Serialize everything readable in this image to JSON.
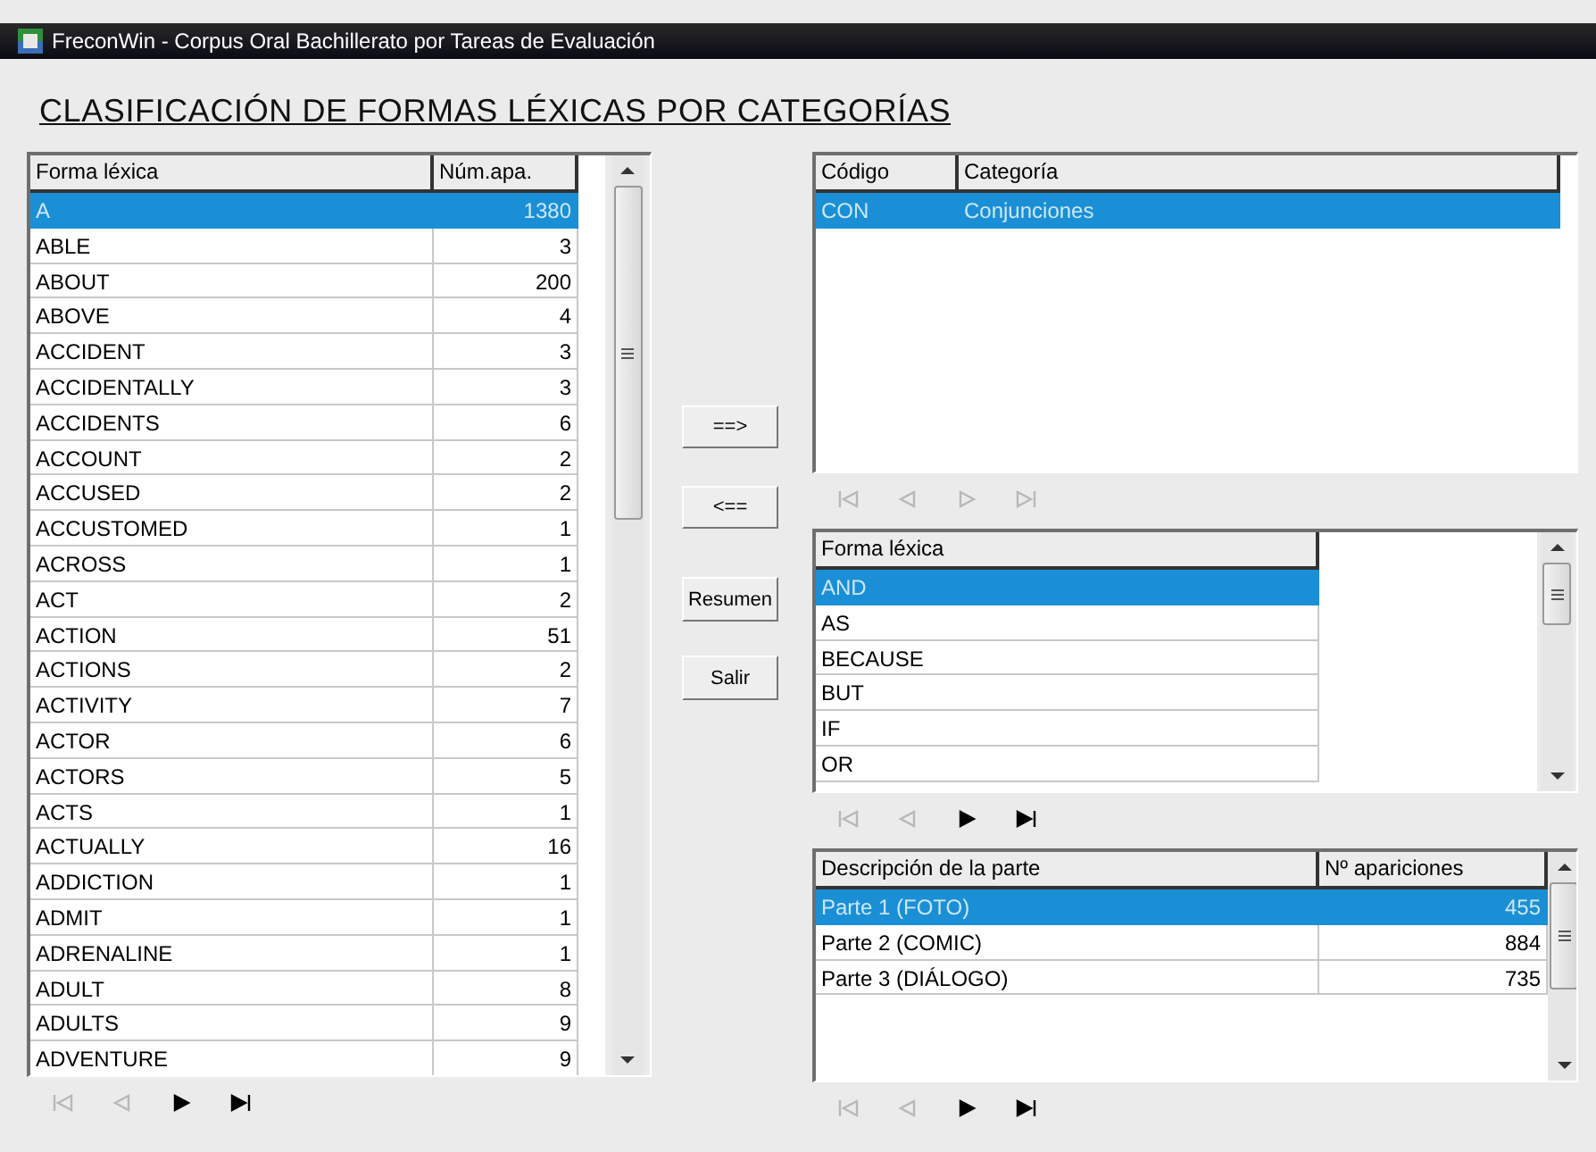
{
  "window": {
    "title": "FreconWin - Corpus Oral Bachillerato por Tareas de Evaluación"
  },
  "heading": "CLASIFICACIÓN DE FORMAS LÉXICAS POR CATEGORÍAS",
  "forms_table": {
    "columns": [
      "Forma léxica",
      "Núm.apa."
    ],
    "rows": [
      {
        "cells": [
          "A",
          "1380"
        ],
        "selected": true
      },
      {
        "cells": [
          "ABLE",
          "3"
        ],
        "selected": false
      },
      {
        "cells": [
          "ABOUT",
          "200"
        ],
        "selected": false
      },
      {
        "cells": [
          "ABOVE",
          "4"
        ],
        "selected": false
      },
      {
        "cells": [
          "ACCIDENT",
          "3"
        ],
        "selected": false
      },
      {
        "cells": [
          "ACCIDENTALLY",
          "3"
        ],
        "selected": false
      },
      {
        "cells": [
          "ACCIDENTS",
          "6"
        ],
        "selected": false
      },
      {
        "cells": [
          "ACCOUNT",
          "2"
        ],
        "selected": false
      },
      {
        "cells": [
          "ACCUSED",
          "2"
        ],
        "selected": false
      },
      {
        "cells": [
          "ACCUSTOMED",
          "1"
        ],
        "selected": false
      },
      {
        "cells": [
          "ACROSS",
          "1"
        ],
        "selected": false
      },
      {
        "cells": [
          "ACT",
          "2"
        ],
        "selected": false
      },
      {
        "cells": [
          "ACTION",
          "51"
        ],
        "selected": false
      },
      {
        "cells": [
          "ACTIONS",
          "2"
        ],
        "selected": false
      },
      {
        "cells": [
          "ACTIVITY",
          "7"
        ],
        "selected": false
      },
      {
        "cells": [
          "ACTOR",
          "6"
        ],
        "selected": false
      },
      {
        "cells": [
          "ACTORS",
          "5"
        ],
        "selected": false
      },
      {
        "cells": [
          "ACTS",
          "1"
        ],
        "selected": false
      },
      {
        "cells": [
          "ACTUALLY",
          "16"
        ],
        "selected": false
      },
      {
        "cells": [
          "ADDICTION",
          "1"
        ],
        "selected": false
      },
      {
        "cells": [
          "ADMIT",
          "1"
        ],
        "selected": false
      },
      {
        "cells": [
          "ADRENALINE",
          "1"
        ],
        "selected": false
      },
      {
        "cells": [
          "ADULT",
          "8"
        ],
        "selected": false
      },
      {
        "cells": [
          "ADULTS",
          "9"
        ],
        "selected": false
      },
      {
        "cells": [
          "ADVENTURE",
          "9"
        ],
        "selected": false
      }
    ],
    "navigator": [
      {
        "kind": "first",
        "disabled": true
      },
      {
        "kind": "prev",
        "disabled": true
      },
      {
        "kind": "next",
        "disabled": false
      },
      {
        "kind": "last",
        "disabled": false
      }
    ]
  },
  "buttons": [
    "==>",
    "<==",
    "Resumen",
    "Salir"
  ],
  "categories_table": {
    "columns": [
      "Código",
      "Categoría"
    ],
    "rows": [
      {
        "cells": [
          "CON",
          "Conjunciones"
        ],
        "selected": true
      }
    ],
    "navigator": [
      {
        "kind": "first",
        "disabled": true
      },
      {
        "kind": "prev",
        "disabled": true
      },
      {
        "kind": "next",
        "disabled": true
      },
      {
        "kind": "last",
        "disabled": true
      }
    ]
  },
  "category_forms_table": {
    "columns": [
      "Forma léxica"
    ],
    "rows": [
      {
        "cells": [
          "AND"
        ],
        "selected": true
      },
      {
        "cells": [
          "AS"
        ],
        "selected": false
      },
      {
        "cells": [
          "BECAUSE"
        ],
        "selected": false
      },
      {
        "cells": [
          "BUT"
        ],
        "selected": false
      },
      {
        "cells": [
          "IF"
        ],
        "selected": false
      },
      {
        "cells": [
          "OR"
        ],
        "selected": false
      }
    ],
    "navigator": [
      {
        "kind": "first",
        "disabled": true
      },
      {
        "kind": "prev",
        "disabled": true
      },
      {
        "kind": "next",
        "disabled": false
      },
      {
        "kind": "last",
        "disabled": false
      }
    ]
  },
  "parts_table": {
    "columns": [
      "Descripción de la parte",
      "Nº apariciones"
    ],
    "rows": [
      {
        "cells": [
          "Parte 1 (FOTO)",
          "455"
        ],
        "selected": true
      },
      {
        "cells": [
          "Parte 2 (COMIC)",
          "884"
        ],
        "selected": false
      },
      {
        "cells": [
          "Parte 3 (DIÁLOGO)",
          "735"
        ],
        "selected": false
      }
    ],
    "navigator": [
      {
        "kind": "first",
        "disabled": true
      },
      {
        "kind": "prev",
        "disabled": true
      },
      {
        "kind": "next",
        "disabled": false
      },
      {
        "kind": "last",
        "disabled": false
      }
    ]
  }
}
